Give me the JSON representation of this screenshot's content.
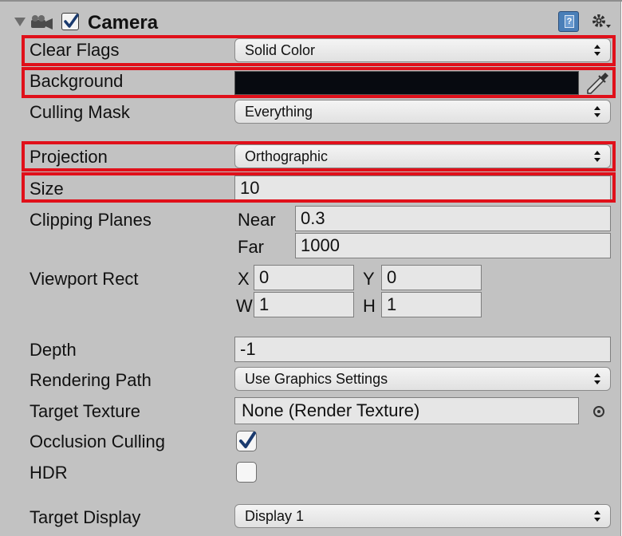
{
  "component": {
    "title": "Camera",
    "enabled": true,
    "icons": [
      "foldout-arrow-icon",
      "camera-icon",
      "help-icon",
      "gear-icon"
    ]
  },
  "rows": {
    "clear_flags": {
      "label": "Clear Flags",
      "value": "Solid Color"
    },
    "background": {
      "label": "Background",
      "color": "#070a10"
    },
    "culling_mask": {
      "label": "Culling Mask",
      "value": "Everything"
    },
    "projection": {
      "label": "Projection",
      "value": "Orthographic"
    },
    "size": {
      "label": "Size",
      "value": "10"
    },
    "clipping_planes": {
      "label": "Clipping Planes",
      "near_label": "Near",
      "near_value": "0.3",
      "far_label": "Far",
      "far_value": "1000"
    },
    "viewport_rect": {
      "label": "Viewport Rect",
      "x_label": "X",
      "x_value": "0",
      "y_label": "Y",
      "y_value": "0",
      "w_label": "W",
      "w_value": "1",
      "h_label": "H",
      "h_value": "1"
    },
    "depth": {
      "label": "Depth",
      "value": "-1"
    },
    "rendering_path": {
      "label": "Rendering Path",
      "value": "Use Graphics Settings"
    },
    "target_texture": {
      "label": "Target Texture",
      "value": "None (Render Texture)"
    },
    "occlusion_culling": {
      "label": "Occlusion Culling",
      "checked": true
    },
    "hdr": {
      "label": "HDR",
      "checked": false
    },
    "target_display": {
      "label": "Target Display",
      "value": "Display 1"
    }
  },
  "colors": {
    "panel_bg": "#c2c2c2",
    "highlight": "#e0101a",
    "field_bg": "#e6e6e6"
  }
}
